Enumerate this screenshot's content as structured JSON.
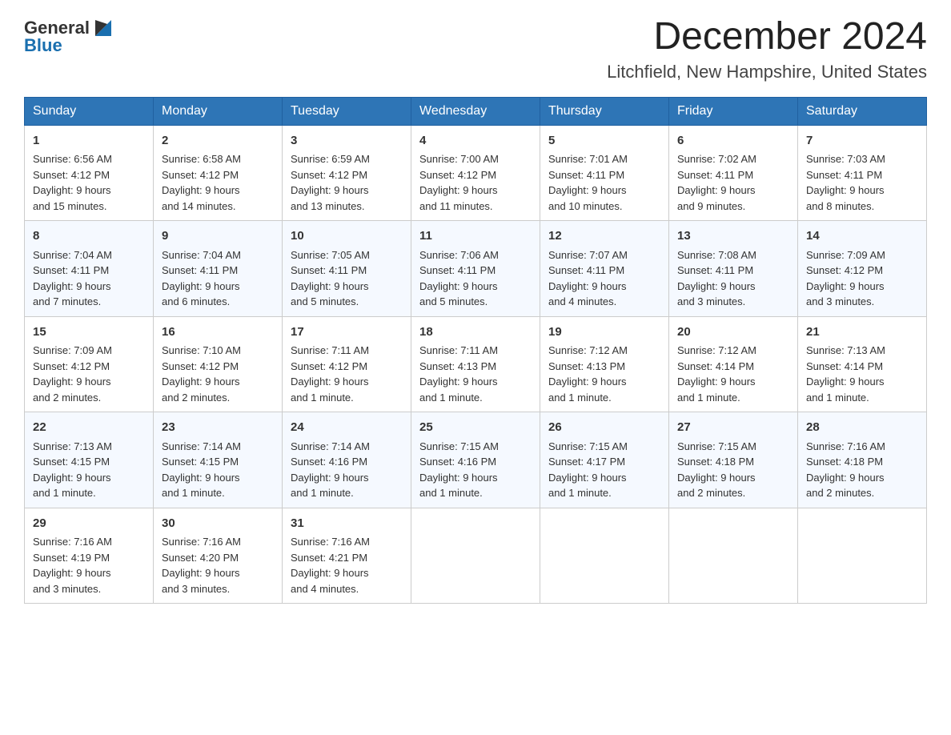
{
  "header": {
    "logo_general": "General",
    "logo_blue": "Blue",
    "title": "December 2024",
    "subtitle": "Litchfield, New Hampshire, United States"
  },
  "days_of_week": [
    "Sunday",
    "Monday",
    "Tuesday",
    "Wednesday",
    "Thursday",
    "Friday",
    "Saturday"
  ],
  "weeks": [
    [
      {
        "day": "1",
        "sunrise": "6:56 AM",
        "sunset": "4:12 PM",
        "daylight": "9 hours and 15 minutes."
      },
      {
        "day": "2",
        "sunrise": "6:58 AM",
        "sunset": "4:12 PM",
        "daylight": "9 hours and 14 minutes."
      },
      {
        "day": "3",
        "sunrise": "6:59 AM",
        "sunset": "4:12 PM",
        "daylight": "9 hours and 13 minutes."
      },
      {
        "day": "4",
        "sunrise": "7:00 AM",
        "sunset": "4:12 PM",
        "daylight": "9 hours and 11 minutes."
      },
      {
        "day": "5",
        "sunrise": "7:01 AM",
        "sunset": "4:11 PM",
        "daylight": "9 hours and 10 minutes."
      },
      {
        "day": "6",
        "sunrise": "7:02 AM",
        "sunset": "4:11 PM",
        "daylight": "9 hours and 9 minutes."
      },
      {
        "day": "7",
        "sunrise": "7:03 AM",
        "sunset": "4:11 PM",
        "daylight": "9 hours and 8 minutes."
      }
    ],
    [
      {
        "day": "8",
        "sunrise": "7:04 AM",
        "sunset": "4:11 PM",
        "daylight": "9 hours and 7 minutes."
      },
      {
        "day": "9",
        "sunrise": "7:04 AM",
        "sunset": "4:11 PM",
        "daylight": "9 hours and 6 minutes."
      },
      {
        "day": "10",
        "sunrise": "7:05 AM",
        "sunset": "4:11 PM",
        "daylight": "9 hours and 5 minutes."
      },
      {
        "day": "11",
        "sunrise": "7:06 AM",
        "sunset": "4:11 PM",
        "daylight": "9 hours and 5 minutes."
      },
      {
        "day": "12",
        "sunrise": "7:07 AM",
        "sunset": "4:11 PM",
        "daylight": "9 hours and 4 minutes."
      },
      {
        "day": "13",
        "sunrise": "7:08 AM",
        "sunset": "4:11 PM",
        "daylight": "9 hours and 3 minutes."
      },
      {
        "day": "14",
        "sunrise": "7:09 AM",
        "sunset": "4:12 PM",
        "daylight": "9 hours and 3 minutes."
      }
    ],
    [
      {
        "day": "15",
        "sunrise": "7:09 AM",
        "sunset": "4:12 PM",
        "daylight": "9 hours and 2 minutes."
      },
      {
        "day": "16",
        "sunrise": "7:10 AM",
        "sunset": "4:12 PM",
        "daylight": "9 hours and 2 minutes."
      },
      {
        "day": "17",
        "sunrise": "7:11 AM",
        "sunset": "4:12 PM",
        "daylight": "9 hours and 1 minute."
      },
      {
        "day": "18",
        "sunrise": "7:11 AM",
        "sunset": "4:13 PM",
        "daylight": "9 hours and 1 minute."
      },
      {
        "day": "19",
        "sunrise": "7:12 AM",
        "sunset": "4:13 PM",
        "daylight": "9 hours and 1 minute."
      },
      {
        "day": "20",
        "sunrise": "7:12 AM",
        "sunset": "4:14 PM",
        "daylight": "9 hours and 1 minute."
      },
      {
        "day": "21",
        "sunrise": "7:13 AM",
        "sunset": "4:14 PM",
        "daylight": "9 hours and 1 minute."
      }
    ],
    [
      {
        "day": "22",
        "sunrise": "7:13 AM",
        "sunset": "4:15 PM",
        "daylight": "9 hours and 1 minute."
      },
      {
        "day": "23",
        "sunrise": "7:14 AM",
        "sunset": "4:15 PM",
        "daylight": "9 hours and 1 minute."
      },
      {
        "day": "24",
        "sunrise": "7:14 AM",
        "sunset": "4:16 PM",
        "daylight": "9 hours and 1 minute."
      },
      {
        "day": "25",
        "sunrise": "7:15 AM",
        "sunset": "4:16 PM",
        "daylight": "9 hours and 1 minute."
      },
      {
        "day": "26",
        "sunrise": "7:15 AM",
        "sunset": "4:17 PM",
        "daylight": "9 hours and 1 minute."
      },
      {
        "day": "27",
        "sunrise": "7:15 AM",
        "sunset": "4:18 PM",
        "daylight": "9 hours and 2 minutes."
      },
      {
        "day": "28",
        "sunrise": "7:16 AM",
        "sunset": "4:18 PM",
        "daylight": "9 hours and 2 minutes."
      }
    ],
    [
      {
        "day": "29",
        "sunrise": "7:16 AM",
        "sunset": "4:19 PM",
        "daylight": "9 hours and 3 minutes."
      },
      {
        "day": "30",
        "sunrise": "7:16 AM",
        "sunset": "4:20 PM",
        "daylight": "9 hours and 3 minutes."
      },
      {
        "day": "31",
        "sunrise": "7:16 AM",
        "sunset": "4:21 PM",
        "daylight": "9 hours and 4 minutes."
      },
      null,
      null,
      null,
      null
    ]
  ],
  "labels": {
    "sunrise": "Sunrise:",
    "sunset": "Sunset:",
    "daylight": "Daylight:"
  }
}
